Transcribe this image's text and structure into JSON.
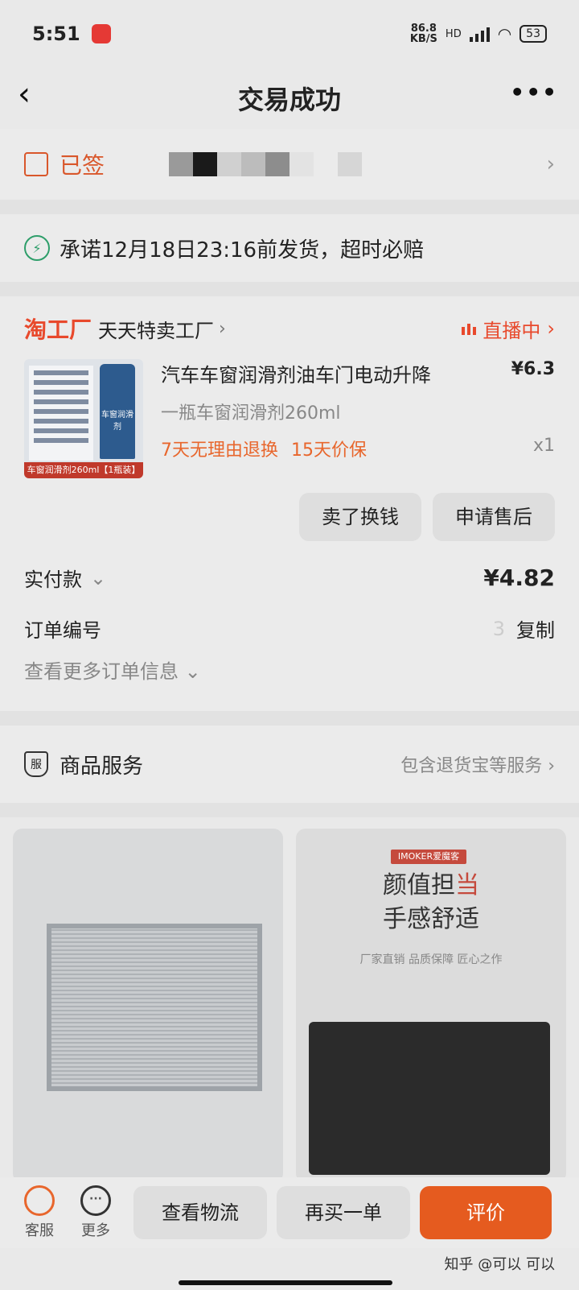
{
  "status_bar": {
    "time": "5:51",
    "net_speed": "86.8",
    "net_unit": "KB/S",
    "hd": "HD",
    "battery": "53"
  },
  "header": {
    "title": "交易成功",
    "back": "‹",
    "more": "•••"
  },
  "delivery": {
    "status": "已签",
    "chevron": "›"
  },
  "promise": {
    "text": "承诺12月18日23:16前发货，超时必赔"
  },
  "shop": {
    "logo": "淘工厂",
    "name": "天天特卖工厂",
    "live": "直播中",
    "chevron": "›"
  },
  "product": {
    "name": "汽车车窗润滑剂油车门电动升降",
    "price": "¥6.3",
    "spec": "一瓶车窗润滑剂260ml",
    "badge1": "7天无理由退换",
    "badge2": "15天价保",
    "qty": "x1",
    "thumb_tag": "车窗润滑剂260ml【1瓶装】",
    "thumb_can": "车窗润滑剂"
  },
  "actions": {
    "sell": "卖了换钱",
    "after_sale": "申请售后"
  },
  "payment": {
    "label": "实付款",
    "amount": "¥4.82"
  },
  "order": {
    "number_label": "订单编号",
    "number_tail": "3",
    "copy": "复制",
    "more_info": "查看更多订单信息"
  },
  "service": {
    "title": "商品服务",
    "link": "包含退货宝等服务 ›",
    "icon_char": "服"
  },
  "recs": {
    "ad_brand": "IMOKER爱魔客",
    "ad_line1a": "颜值担",
    "ad_line1b": "当",
    "ad_line2": "手感舒适",
    "ad_sub": "厂家直销  品质保障  匠心之作"
  },
  "bottom": {
    "service": "客服",
    "more": "更多",
    "logistics": "查看物流",
    "rebuy": "再买一单",
    "review": "评价"
  },
  "watermark": "知乎 @可以 可以"
}
